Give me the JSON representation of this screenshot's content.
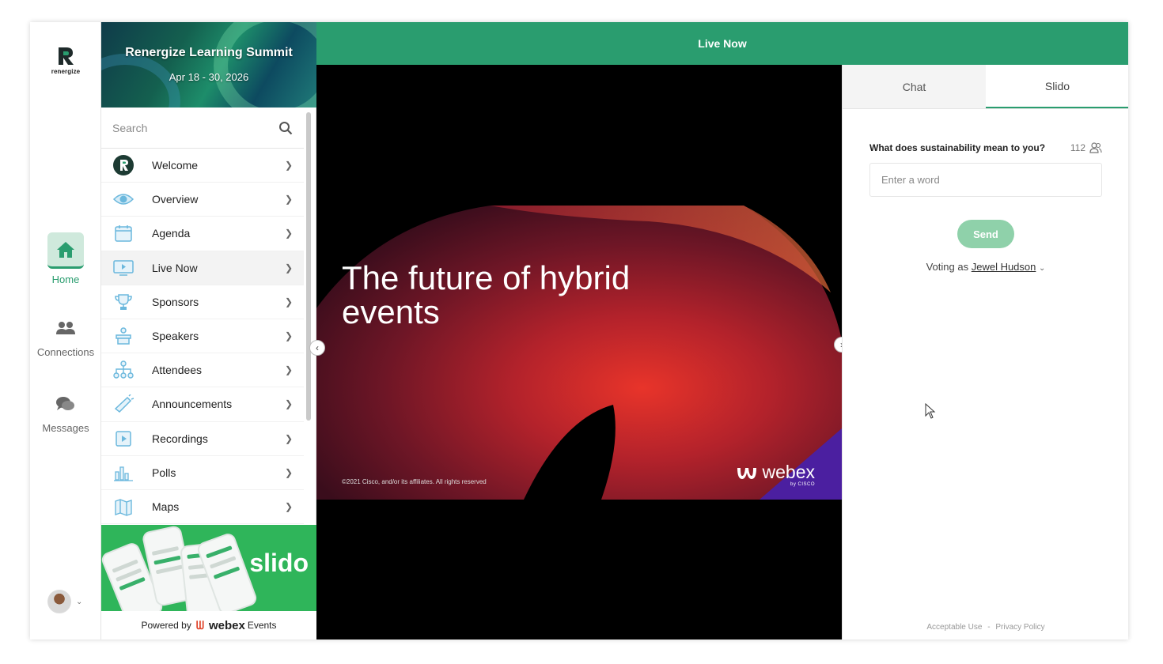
{
  "brand": {
    "logo_text": "renergize",
    "accent": "#2a9d6f"
  },
  "rail": {
    "home": "Home",
    "connections": "Connections",
    "messages": "Messages"
  },
  "event": {
    "title": "Renergize Learning Summit",
    "dates": "Apr 18 - 30, 2026"
  },
  "search": {
    "placeholder": "Search"
  },
  "menu": [
    {
      "label": "Welcome",
      "icon": "welcome-logo-icon"
    },
    {
      "label": "Overview",
      "icon": "eye-icon"
    },
    {
      "label": "Agenda",
      "icon": "calendar-icon"
    },
    {
      "label": "Live Now",
      "icon": "monitor-play-icon"
    },
    {
      "label": "Sponsors",
      "icon": "trophy-icon"
    },
    {
      "label": "Speakers",
      "icon": "podium-icon"
    },
    {
      "label": "Attendees",
      "icon": "network-icon"
    },
    {
      "label": "Announcements",
      "icon": "megaphone-icon"
    },
    {
      "label": "Recordings",
      "icon": "video-icon"
    },
    {
      "label": "Polls",
      "icon": "bar-chart-icon"
    },
    {
      "label": "Maps",
      "icon": "map-icon"
    }
  ],
  "promo": {
    "word": "slido",
    "powered_by": "Powered by",
    "product": "webex",
    "product_suffix": "Events"
  },
  "topbar": {
    "title": "Live Now"
  },
  "slide": {
    "title": "The future of hybrid events",
    "copyright": "©2021 Cisco, and/or its affiliates. All rights reserved",
    "brand": "webex",
    "brand_by": "by CISCO"
  },
  "panel": {
    "tabs": [
      "Chat",
      "Slido"
    ],
    "active_tab": "Slido",
    "question": "What does sustainability mean to you?",
    "participants": "112",
    "input_placeholder": "Enter a word",
    "send_label": "Send",
    "voting_prefix": "Voting as",
    "voting_name": "Jewel Hudson",
    "footer_left": "Acceptable Use",
    "footer_sep": "-",
    "footer_right": "Privacy Policy"
  }
}
